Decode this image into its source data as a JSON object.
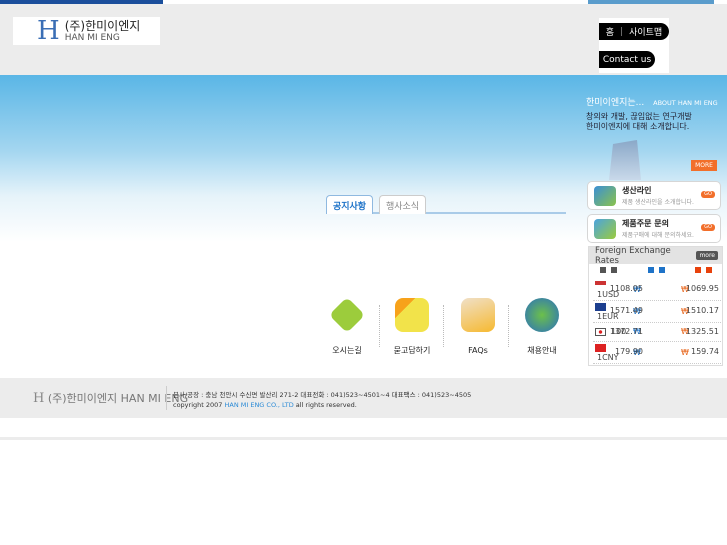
{
  "header": {
    "logo_mark": "H",
    "logo_ko": "(주)한미이엔지",
    "logo_en": "HAN MI ENG",
    "home": "홈",
    "sitemap": "사이트맵",
    "contact": "Contact us"
  },
  "about": {
    "title": "한미이엔지는...",
    "title_en": "ABOUT HAN MI ENG",
    "desc1": "창의와 개발, 끊임없는 연구개발",
    "desc2": "한미이엔지에 대해 소개합니다.",
    "more": "MORE"
  },
  "cards": [
    {
      "title": "생산라인",
      "sub": "제품 생산라인을 소개합니다.",
      "go": "GO"
    },
    {
      "title": "제품주문 문의",
      "sub": "제품구매에 대해 문의하세요.",
      "go": "GO"
    }
  ],
  "tabs": [
    "공지사항",
    "행사소식"
  ],
  "quick": [
    "오시는길",
    "묻고답하기",
    "FAQs",
    "채용안내"
  ],
  "fx": {
    "title": "Foreign Exchange Rates",
    "more": "more",
    "won": "₩",
    "rows": [
      {
        "cur": "1USD",
        "buy": "1108.05",
        "sell": "1069.95"
      },
      {
        "cur": "1EUR",
        "buy": "1571.49",
        "sell": "1510.17"
      },
      {
        "cur": "100",
        "buy": "1372.71",
        "sell": "1325.51"
      },
      {
        "cur": "1CNY",
        "buy": "179.90",
        "sell": "159.74"
      }
    ]
  },
  "footer": {
    "logo_mark": "H",
    "logo": "(주)한미이엔지 HAN MI ENG",
    "address": "본사/공장 : 충남 천안시 수신면 발산리 271-2   대표전화 : 041)523~4501~4   대표팩스 : 041)523~4505",
    "copy_pre": "copyright 2007 ",
    "copy_company": "HAN MI ENG CO., LTD",
    "copy_post": " all rights reserved."
  }
}
